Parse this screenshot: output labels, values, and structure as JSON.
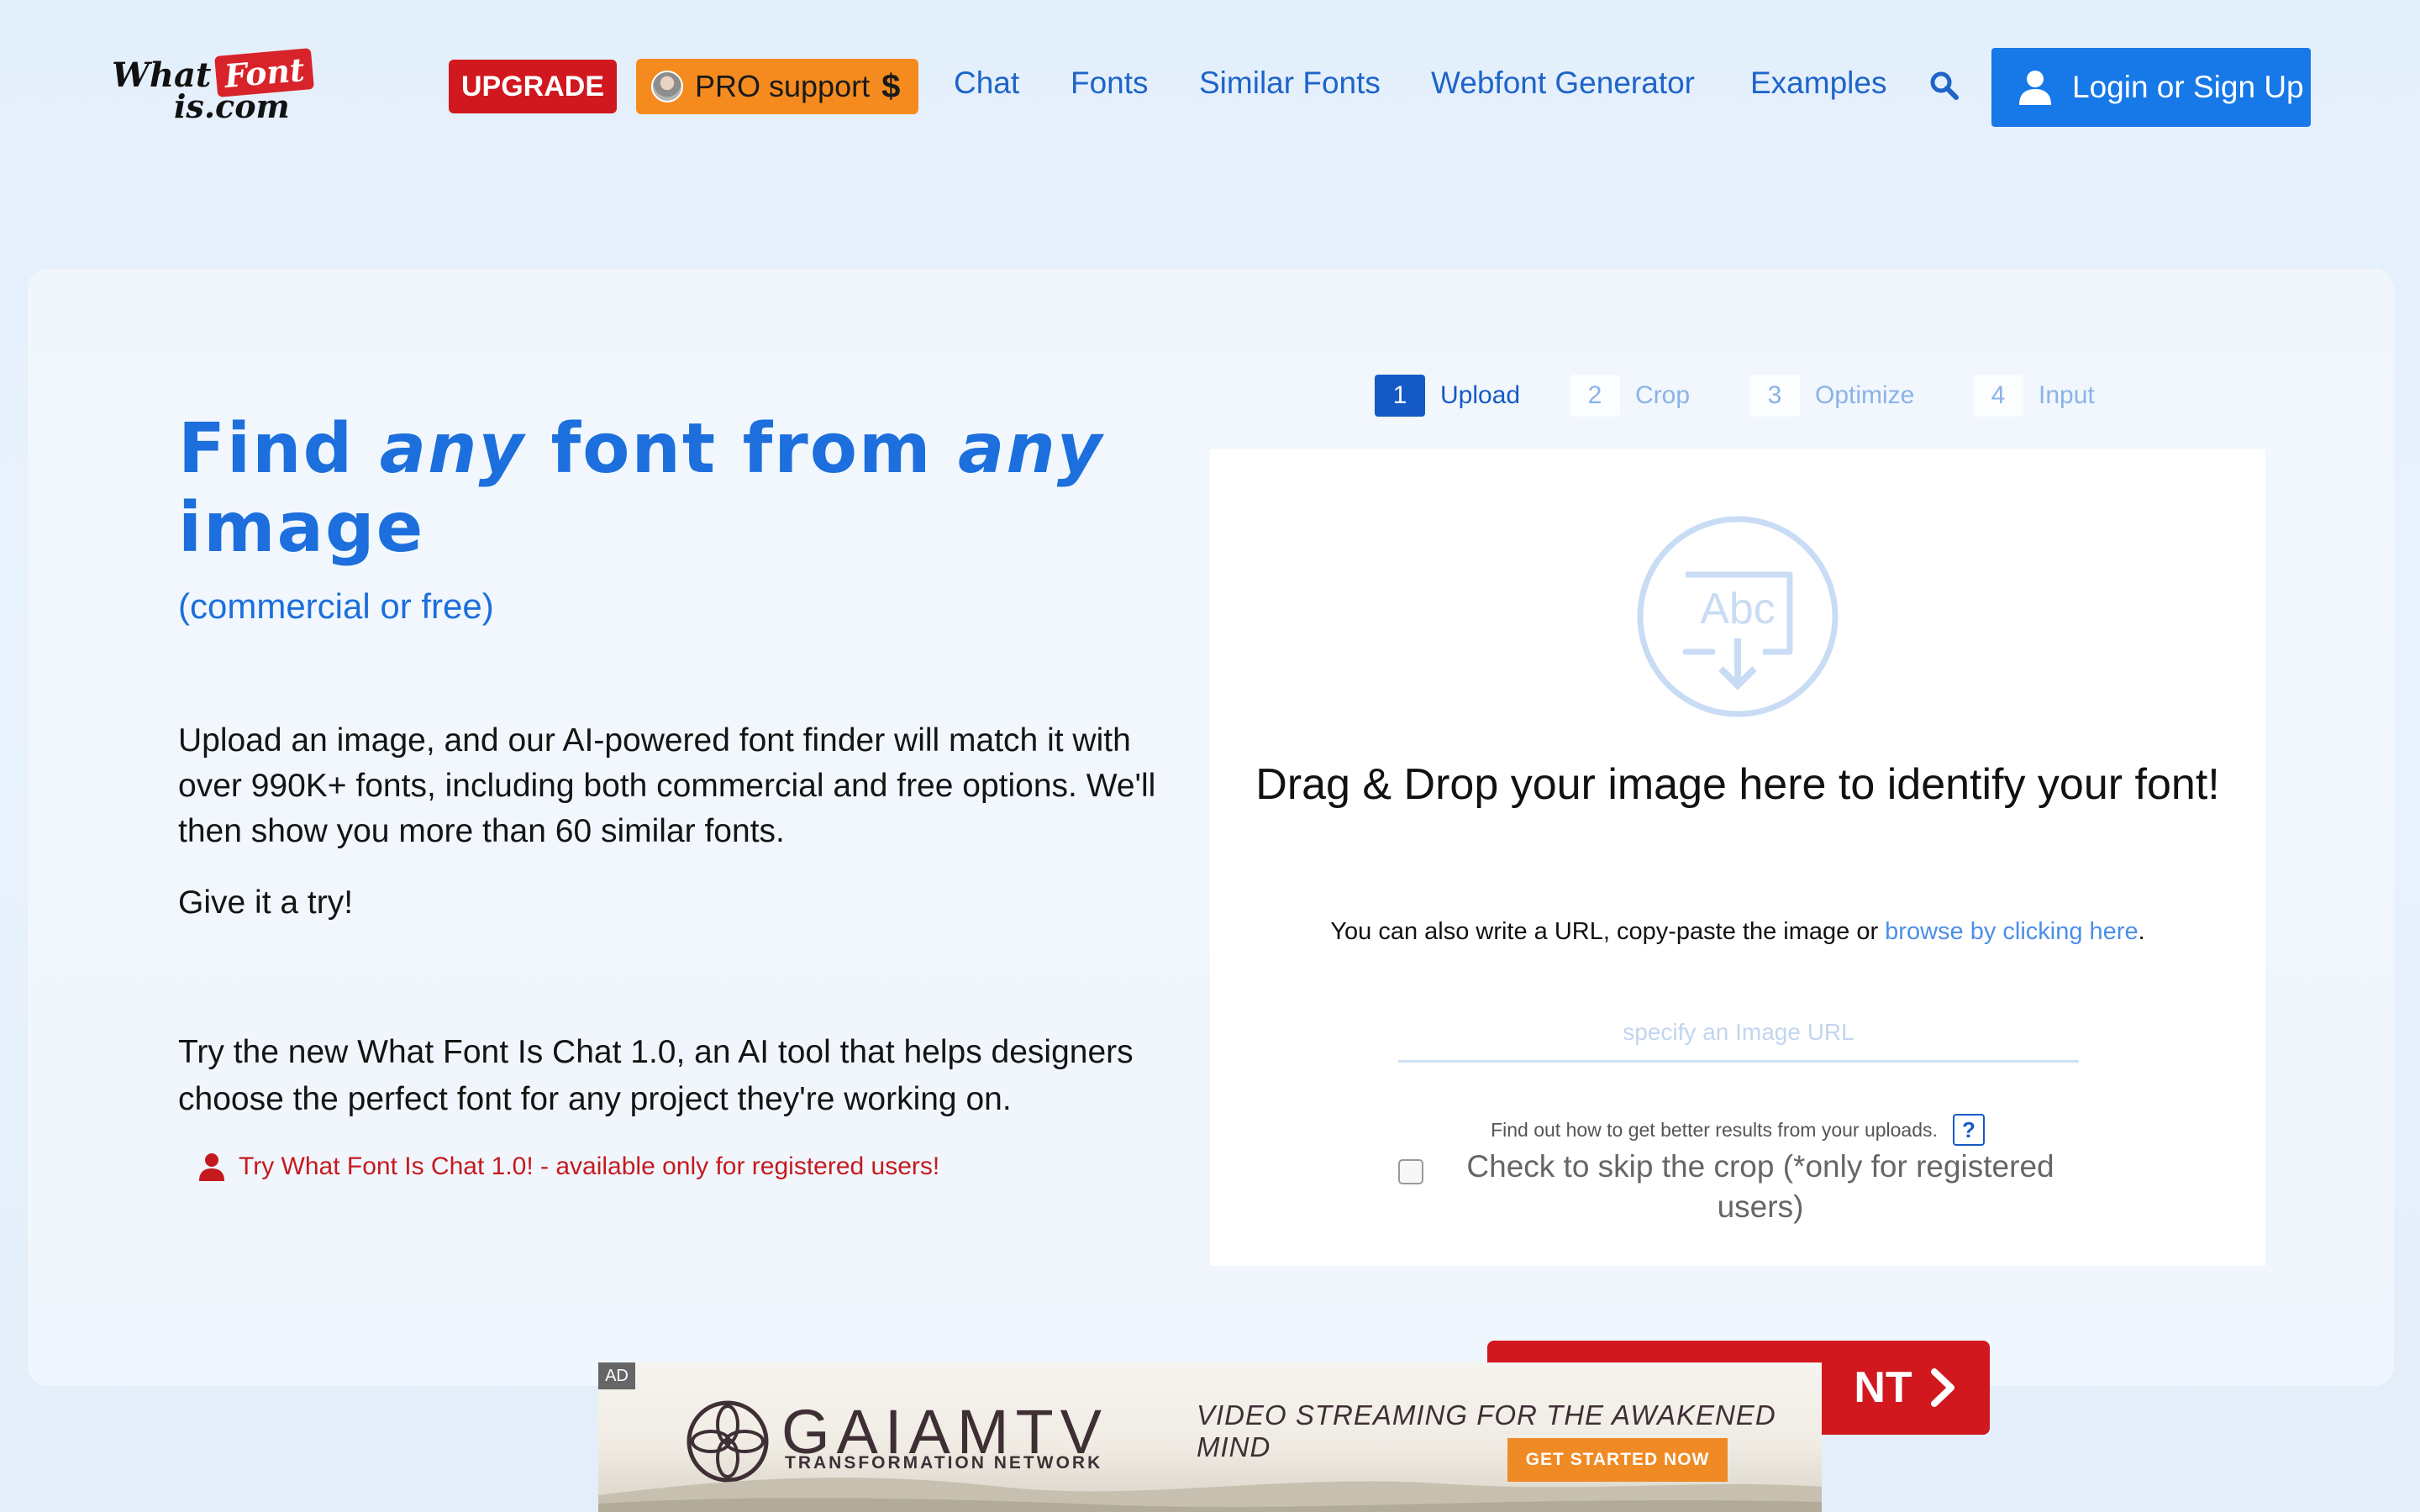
{
  "header": {
    "logo": {
      "word1": "What",
      "word2": "Font",
      "word3": "is.com"
    },
    "upgrade_label": "UPGRADE",
    "pro_support_label": "PRO support",
    "pro_support_symbol": "$",
    "nav": {
      "chat": "Chat",
      "fonts": "Fonts",
      "similar_fonts": "Similar Fonts",
      "webfont_generator": "Webfont Generator",
      "examples": "Examples"
    },
    "login_label": "Login or Sign Up"
  },
  "hero": {
    "title_part1": "Find ",
    "title_em1": "any",
    "title_part2": " font from ",
    "title_em2": "any",
    "title_part3": " image",
    "subtitle": "(commercial or free)",
    "intro": "Upload an image, and our AI-powered font finder will match it with over 990K+ fonts, including both commercial and free options. We'll then show you more than 60 similar fonts.",
    "try": "Give it a try!",
    "chat_desc": "Try the new What Font Is Chat 1.0, an AI tool that helps designers choose the perfect font for any project they're working on.",
    "chat_link": "Try What Font Is Chat 1.0! - available only for registered users!"
  },
  "steps": [
    {
      "num": "1",
      "label": "Upload",
      "active": true
    },
    {
      "num": "2",
      "label": "Crop",
      "active": false
    },
    {
      "num": "3",
      "label": "Optimize",
      "active": false
    },
    {
      "num": "4",
      "label": "Input",
      "active": false
    }
  ],
  "upload": {
    "icon_text": "Abc",
    "drop_title": "Drag & Drop your image here to identify your font!",
    "also_text": "You can also write a URL, copy-paste the image or ",
    "browse_link": "browse by clicking here",
    "also_end": ".",
    "url_placeholder": "specify an Image URL",
    "url_value": "",
    "tips_text": "Find out how to get better results from your uploads.",
    "tips_icon": "?",
    "skip_label": "Check to skip the crop (*only for registered users)",
    "skip_checked": false
  },
  "cta_label": "NT",
  "ad": {
    "label": "AD",
    "brand": "GAIAMTV",
    "brand_sub": "TRANSFORMATION NETWORK",
    "tagline": "VIDEO STREAMING FOR THE AWAKENED MIND",
    "cta": "GET STARTED NOW"
  },
  "colors": {
    "brand_blue": "#1c6fdc",
    "upgrade_red": "#d0181e",
    "pro_orange": "#f58b1f",
    "login_blue": "#1778e8"
  }
}
